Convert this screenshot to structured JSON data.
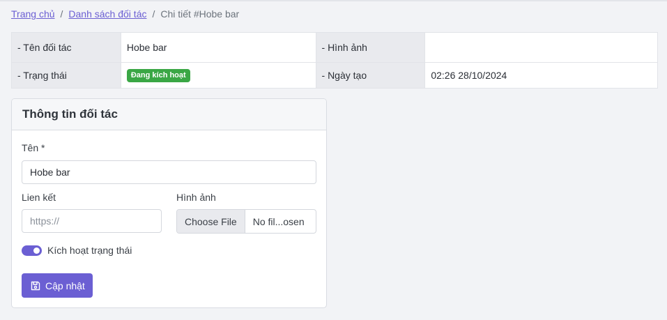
{
  "breadcrumb": {
    "home": "Trang chủ",
    "list": "Danh sách đối tác",
    "separator": "/",
    "current": "Chi tiết #Hobe bar"
  },
  "summary": {
    "name_label": "- Tên đối tác",
    "name_value": "Hobe bar",
    "image_label": "- Hình ảnh",
    "image_value": "",
    "status_label": "- Trạng thái",
    "status_value": "Đang kích hoạt",
    "created_label": "- Ngày tạo",
    "created_value": "02:26 28/10/2024"
  },
  "form": {
    "title": "Thông tin đối tác",
    "name_label": "Tên *",
    "name_value": "Hobe bar",
    "link_label": "Lien kết",
    "link_placeholder": "https://",
    "image_label": "Hình ảnh",
    "file_button": "Choose File",
    "file_name": "No fil...osen",
    "toggle_label": "Kích hoạt trạng thái",
    "toggle_on": true,
    "submit_label": "Cập nhật"
  },
  "colors": {
    "accent": "#6b5fd3",
    "status_active": "#3aa745"
  }
}
